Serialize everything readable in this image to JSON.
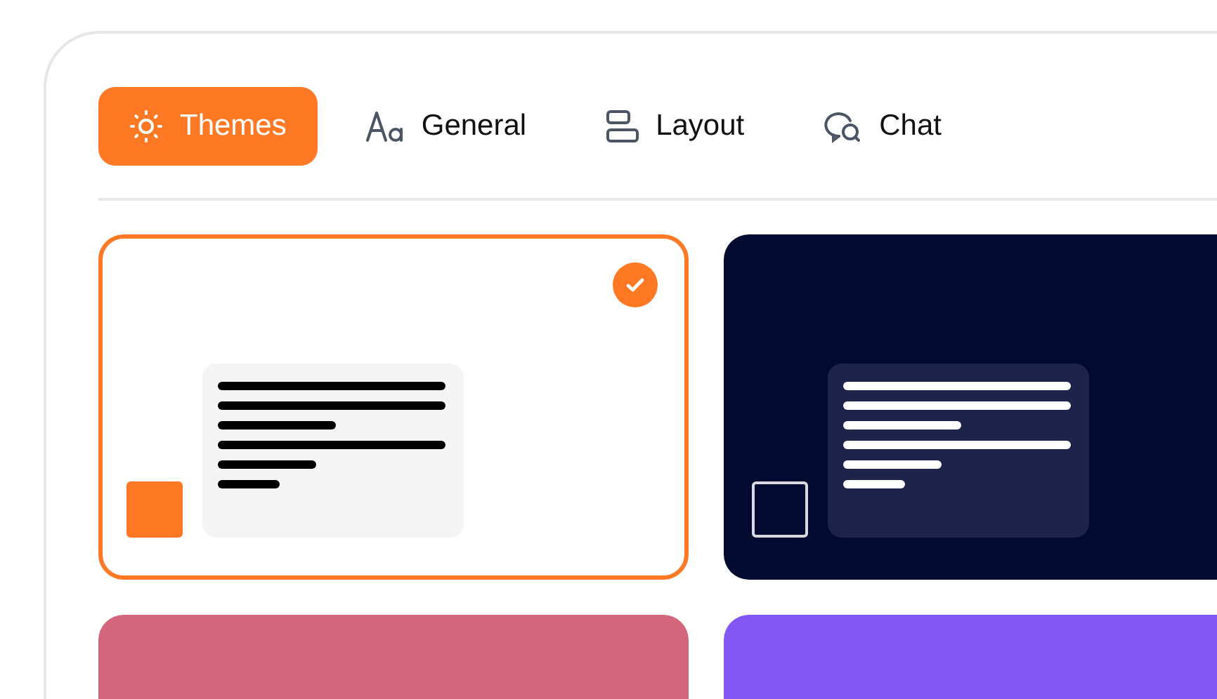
{
  "tabs": [
    {
      "label": "Themes",
      "kind": "sun",
      "selected": true
    },
    {
      "label": "General",
      "kind": "font",
      "selected": false
    },
    {
      "label": "Layout",
      "kind": "layout",
      "selected": false
    },
    {
      "label": "Chat",
      "kind": "chat",
      "selected": false
    }
  ],
  "themes": [
    {
      "kind": "light",
      "color": "#ffffff",
      "selected": true
    },
    {
      "kind": "dark",
      "color": "#020a30",
      "selected": false
    },
    {
      "color": "#d3667b",
      "selected": false
    },
    {
      "color": "#8257f5",
      "selected": false
    }
  ]
}
